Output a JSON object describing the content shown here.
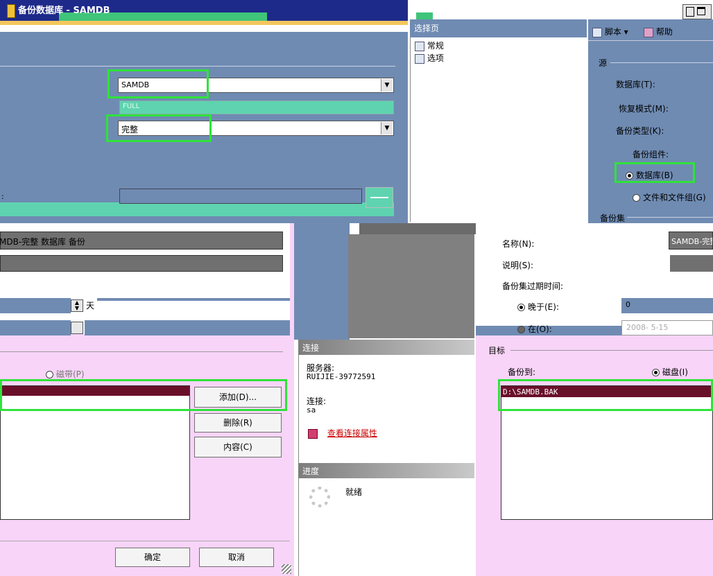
{
  "window": {
    "title": "备份数据库 - SAMDB"
  },
  "sidebar": {
    "header": "选择页",
    "items": [
      {
        "label": "常规"
      },
      {
        "label": "选项"
      }
    ]
  },
  "toolbar": {
    "script_label": "脚本",
    "help_label": "帮助"
  },
  "source": {
    "section_label": "源",
    "database_label": "数据库(T):",
    "database_value": "SAMDB",
    "recovery_label": "恢复模式(M):",
    "recovery_value": "FULL",
    "backup_type_label": "备份类型(K):",
    "backup_type_value": "完整",
    "backup_component_label": "备份组件:",
    "component_database_label": "数据库(B)",
    "component_files_label": "文件和文件组(G)"
  },
  "backup_set": {
    "section_label": "备份集",
    "name_label": "名称(N):",
    "name_value": "SAMDB-完整 数据库 备份",
    "description_label": "说明(S):",
    "expire_label": "备份集过期时间:",
    "after_label": "晚于(E):",
    "after_value": "0",
    "days_unit": "天",
    "on_label": "在(O):",
    "on_value": "2008- 5-15"
  },
  "destination": {
    "section_label": "目标",
    "backup_to_label": "备份到:",
    "disk_label": "磁盘(I)",
    "tape_label": "磁带(P)",
    "path_item": "D:\\SAMDB.BAK",
    "add_label": "添加(D)...",
    "remove_label": "删除(R)",
    "contents_label": "内容(C)"
  },
  "connection": {
    "header": "连接",
    "server_label": "服务器:",
    "server_value": "RUIJIE-39772591",
    "connect_label": "连接:",
    "connect_value": "sa",
    "view_props_link": "查看连接属性"
  },
  "progress": {
    "header": "进度",
    "status": "就绪"
  },
  "footer": {
    "ok_label": "确定",
    "cancel_label": "取消"
  },
  "colors": {
    "accent_green": "#2ee33a",
    "panel_blue": "#6f8bb2",
    "panel_pink": "#f8d4f8",
    "teal": "#5fd3b0",
    "maroon": "#6a0f2a"
  }
}
